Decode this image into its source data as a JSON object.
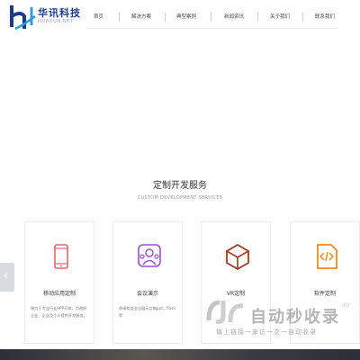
{
  "logo": {
    "cn": "华讯科技",
    "en": "HUAXUN.NET"
  },
  "nav": [
    {
      "label": "首页"
    },
    {
      "label": "解决方案"
    },
    {
      "label": "典型案例"
    },
    {
      "label": "新闻资讯"
    },
    {
      "label": "关于我们"
    },
    {
      "label": "联系我们"
    }
  ],
  "section": {
    "title": "定制开发服务",
    "subtitle": "CUSTOM DEVELOPMENT SERVICES"
  },
  "cards": [
    {
      "title": "移动应用定制",
      "desc": "致力于专业行业APP开发，为政府企业、企业及个人提供开发服务。",
      "icon": "mobile-phone-icon",
      "color": "#e8636b"
    },
    {
      "title": "会议演示",
      "desc": "承接各类会议展示文稿ppt，flash等",
      "icon": "presentation-audience-icon",
      "color": "#9b4fd6"
    },
    {
      "title": "VR定制",
      "desc": "",
      "icon": "vr-cube-icon",
      "color": "#a53a1f"
    },
    {
      "title": "软件定制",
      "desc": "",
      "icon": "code-icon",
      "color": "#f08a1c"
    }
  ],
  "watermark": {
    "main": "自动秒收录",
    "sub": "做上链接一来访一次一自动收录",
    "tail": "dU"
  },
  "colors": {
    "brand": "#1b3a8a",
    "text": "#333333"
  }
}
